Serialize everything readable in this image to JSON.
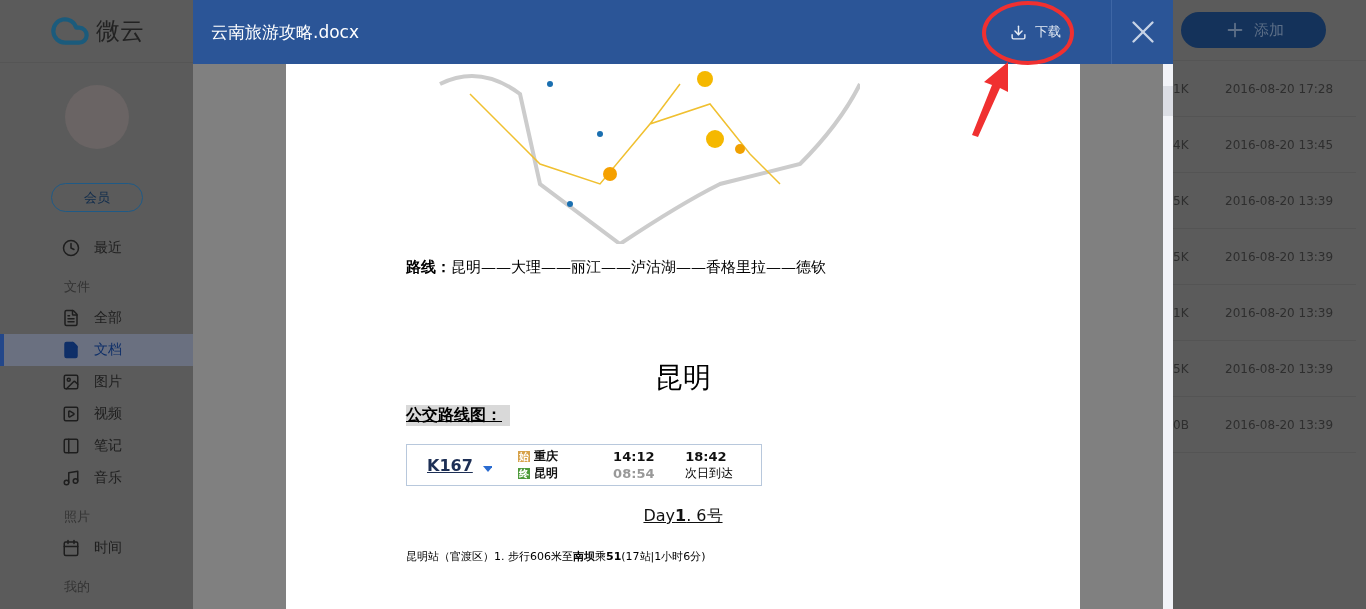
{
  "app": {
    "logo": "微云",
    "add_button": "添加"
  },
  "sidebar": {
    "member_button": "会员",
    "items": [
      {
        "kind": "item",
        "label": "最近",
        "selected": false
      },
      {
        "kind": "section",
        "label": "文件"
      },
      {
        "kind": "item",
        "label": "全部",
        "selected": false
      },
      {
        "kind": "item",
        "label": "文档",
        "selected": true
      },
      {
        "kind": "item",
        "label": "图片",
        "selected": false
      },
      {
        "kind": "item",
        "label": "视频",
        "selected": false
      },
      {
        "kind": "item",
        "label": "笔记",
        "selected": false
      },
      {
        "kind": "item",
        "label": "音乐",
        "selected": false
      },
      {
        "kind": "section",
        "label": "照片"
      },
      {
        "kind": "item",
        "label": "时间",
        "selected": false
      },
      {
        "kind": "section",
        "label": "我的"
      }
    ]
  },
  "file_list": {
    "rows": [
      {
        "size": "1K",
        "date": "2016-08-20 17:28"
      },
      {
        "size": "4K",
        "date": "2016-08-20 13:45"
      },
      {
        "size": "5K",
        "date": "2016-08-20 13:39"
      },
      {
        "size": "5K",
        "date": "2016-08-20 13:39"
      },
      {
        "size": "1K",
        "date": "2016-08-20 13:39"
      },
      {
        "size": "5K",
        "date": "2016-08-20 13:39"
      },
      {
        "size": "0B",
        "date": "2016-08-20 13:39"
      }
    ]
  },
  "preview": {
    "title": "云南旅游攻略.docx",
    "download_button": "下载",
    "document": {
      "route": "**路线：**昆明——大理——丽江——泸沽湖——香格里拉——德钦",
      "heading": "昆明",
      "subheading": "公交路线图：",
      "ticket": {
        "train": "K167",
        "from_badge": "始",
        "from": "重庆",
        "to_badge": "终",
        "to": "昆明",
        "depart_time": "14:12",
        "start_time": "08:54",
        "arrive_time": "18:42",
        "arrive_note": "次日到达"
      },
      "day_line": "Day**1**. 6号",
      "directions": "昆明站（官渡区）1. 步行606米至**南坝**乘**51**(17站|1小时6分)"
    }
  }
}
